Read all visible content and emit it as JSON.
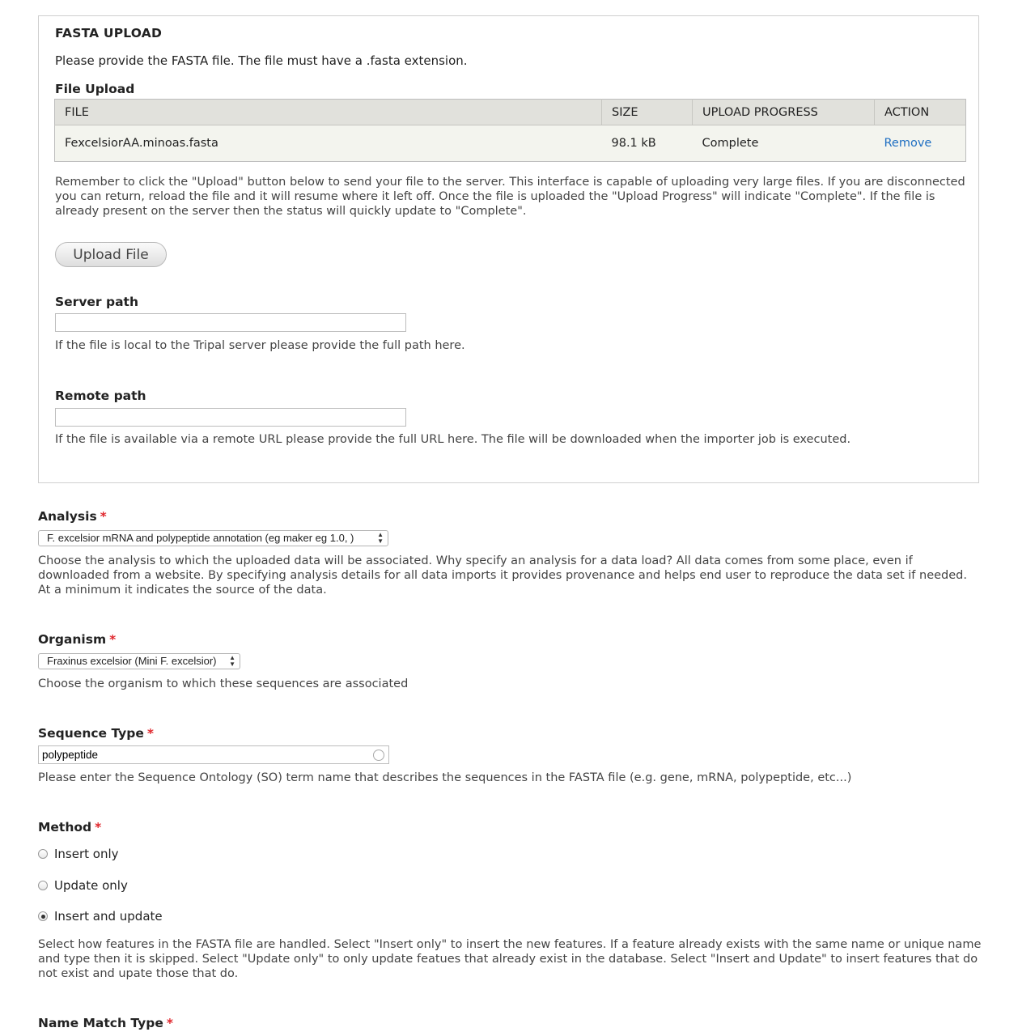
{
  "fasta_upload": {
    "legend": "FASTA UPLOAD",
    "intro": "Please provide the FASTA file. The file must have a .fasta extension.",
    "file_upload_label": "File Upload",
    "table": {
      "headers": [
        "FILE",
        "SIZE",
        "UPLOAD PROGRESS",
        "ACTION"
      ],
      "rows": [
        {
          "file": "FexcelsiorAA.minoas.fasta",
          "size": "98.1 kB",
          "progress": "Complete",
          "action": "Remove"
        }
      ]
    },
    "upload_help": "Remember to click the \"Upload\" button below to send your file to the server. This interface is capable of uploading very large files. If you are disconnected you can return, reload the file and it will resume where it left off. Once the file is uploaded the \"Upload Progress\" will indicate \"Complete\". If the file is already present on the server then the status will quickly update to \"Complete\".",
    "upload_button": "Upload File",
    "server_path": {
      "label": "Server path",
      "value": "",
      "help": "If the file is local to the Tripal server please provide the full path here."
    },
    "remote_path": {
      "label": "Remote path",
      "value": "",
      "help": "If the file is available via a remote URL please provide the full URL here. The file will be downloaded when the importer job is executed."
    }
  },
  "analysis": {
    "label": "Analysis",
    "required_mark": "*",
    "selected": "F. excelsior mRNA and polypeptide annotation (eg maker eg 1.0, )",
    "help": "Choose the analysis to which the uploaded data will be associated. Why specify an analysis for a data load? All data comes from some place, even if downloaded from a website. By specifying analysis details for all data imports it provides provenance and helps end user to reproduce the data set if needed. At a minimum it indicates the source of the data."
  },
  "organism": {
    "label": "Organism",
    "required_mark": "*",
    "selected": "Fraxinus excelsior (Mini F. excelsior)",
    "help": "Choose the organism to which these sequences are associated"
  },
  "sequence_type": {
    "label": "Sequence Type",
    "required_mark": "*",
    "value": "polypeptide",
    "help": "Please enter the Sequence Ontology (SO) term name that describes the sequences in the FASTA file (e.g. gene, mRNA, polypeptide, etc...)"
  },
  "method": {
    "label": "Method",
    "required_mark": "*",
    "options": [
      {
        "label": "Insert only",
        "checked": false
      },
      {
        "label": "Update only",
        "checked": false
      },
      {
        "label": "Insert and update",
        "checked": true
      }
    ],
    "help": "Select how features in the FASTA file are handled. Select \"Insert only\" to insert the new features. If a feature already exists with the same name or unique name and type then it is skipped. Select \"Update only\" to only update featues that already exist in the database. Select \"Insert and Update\" to insert features that do not exist and upate those that do."
  },
  "name_match_type": {
    "label": "Name Match Type",
    "required_mark": "*"
  }
}
